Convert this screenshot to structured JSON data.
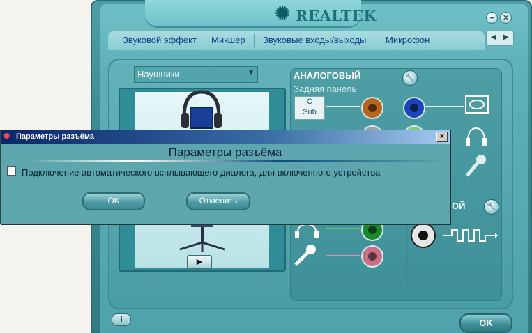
{
  "app": {
    "logo_text": "REALTEK",
    "tabs": [
      "Звуковой эффект",
      "Микшер",
      "Звуковые входы/выходы",
      "Микрофон"
    ],
    "device": "Наушники",
    "analog_title": "АНАЛОГОВЫЙ",
    "back_panel": "Задняя панель",
    "digital_title": "ОЙ",
    "cs_label_top": "C",
    "cs_label_bottom": "Sub",
    "ok_label": "OK"
  },
  "dialog": {
    "title": "Параметры разъёма",
    "heading": "Параметры разъёма",
    "checkbox_label": "Подключение автоматического всплывающего диалога, для включенного устройства",
    "checkbox_checked": false,
    "ok_label": "OK",
    "cancel_label": "Отменить"
  },
  "icons": {
    "minimize": "minimize-icon",
    "close": "close-icon",
    "info": "info-icon",
    "play": "play-icon"
  },
  "colors": {
    "window_teal": "#4fa2aa",
    "tab_text": "#123e86",
    "titlebar": "#0a246a"
  }
}
